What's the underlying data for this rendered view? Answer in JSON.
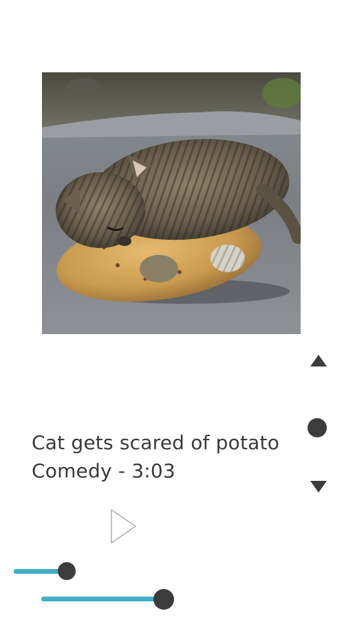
{
  "video": {
    "thumbnail_icon": "kitten-on-potato-image",
    "title": "Cat gets scared of potato",
    "subtitle": "Comedy - 3:03"
  },
  "controls": {
    "play_icon": "play-icon",
    "scroll_up_icon": "triangle-up-icon",
    "scroll_thumb_icon": "circle-thumb-icon",
    "scroll_down_icon": "triangle-down-icon"
  },
  "sliders": [
    {
      "name": "slider-1",
      "value": 0.83
    },
    {
      "name": "slider-2",
      "value": 0.9
    }
  ],
  "colors": {
    "accent": "#41aec8",
    "knob": "#3c3c3c",
    "text": "#3a3a3a"
  }
}
